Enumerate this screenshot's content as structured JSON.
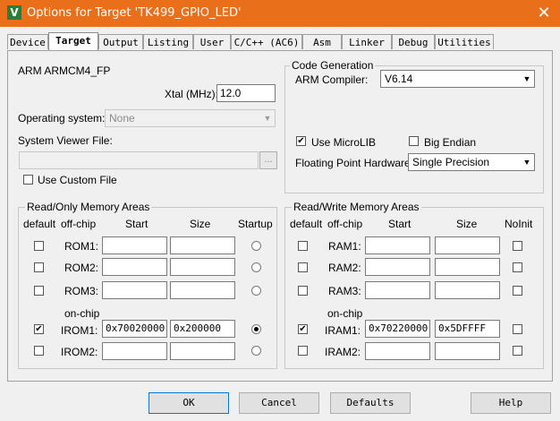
{
  "window": {
    "title": "Options for Target 'TK499_GPIO_LED'",
    "logo": "V",
    "close": "✕"
  },
  "tabs": [
    "Device",
    "Target",
    "Output",
    "Listing",
    "User",
    "C/C++ (AC6)",
    "Asm",
    "Linker",
    "Debug",
    "Utilities"
  ],
  "target": {
    "device": "ARM ARMCM4_FP",
    "xtal_label": "Xtal (MHz):",
    "xtal_value": "12.0",
    "os_label": "Operating system:",
    "os_value": "None",
    "svf_label": "System Viewer File:",
    "svf_value": "",
    "browse": "...",
    "use_custom_file": "Use Custom File"
  },
  "codegen": {
    "title": "Code Generation",
    "compiler_label": "ARM Compiler:",
    "compiler_value": "V6.14",
    "microlib": "Use MicroLIB",
    "microlib_checked": true,
    "big_endian": "Big Endian",
    "big_endian_checked": false,
    "fph_label": "Floating Point Hardware:",
    "fph_value": "Single Precision"
  },
  "rom": {
    "title": "Read/Only Memory Areas",
    "headers": {
      "default": "default",
      "offchip": "off-chip",
      "start": "Start",
      "size": "Size",
      "startup": "Startup"
    },
    "onchip": "on-chip",
    "rows": [
      {
        "label": "ROM1:",
        "start": "",
        "size": "",
        "default": false,
        "startup": false
      },
      {
        "label": "ROM2:",
        "start": "",
        "size": "",
        "default": false,
        "startup": false
      },
      {
        "label": "ROM3:",
        "start": "",
        "size": "",
        "default": false,
        "startup": false
      },
      {
        "label": "IROM1:",
        "start": "0x70020000",
        "size": "0x200000",
        "default": true,
        "startup": true
      },
      {
        "label": "IROM2:",
        "start": "",
        "size": "",
        "default": false,
        "startup": false
      }
    ]
  },
  "ram": {
    "title": "Read/Write Memory Areas",
    "headers": {
      "default": "default",
      "offchip": "off-chip",
      "start": "Start",
      "size": "Size",
      "noinit": "NoInit"
    },
    "onchip": "on-chip",
    "rows": [
      {
        "label": "RAM1:",
        "start": "",
        "size": "",
        "default": false,
        "noinit": false
      },
      {
        "label": "RAM2:",
        "start": "",
        "size": "",
        "default": false,
        "noinit": false
      },
      {
        "label": "RAM3:",
        "start": "",
        "size": "",
        "default": false,
        "noinit": false
      },
      {
        "label": "IRAM1:",
        "start": "0x70220000",
        "size": "0x5DFFFF",
        "default": true,
        "noinit": false
      },
      {
        "label": "IRAM2:",
        "start": "",
        "size": "",
        "default": false,
        "noinit": false
      }
    ]
  },
  "buttons": {
    "ok": "OK",
    "cancel": "Cancel",
    "defaults": "Defaults",
    "help": "Help"
  },
  "check_mark": "✔"
}
